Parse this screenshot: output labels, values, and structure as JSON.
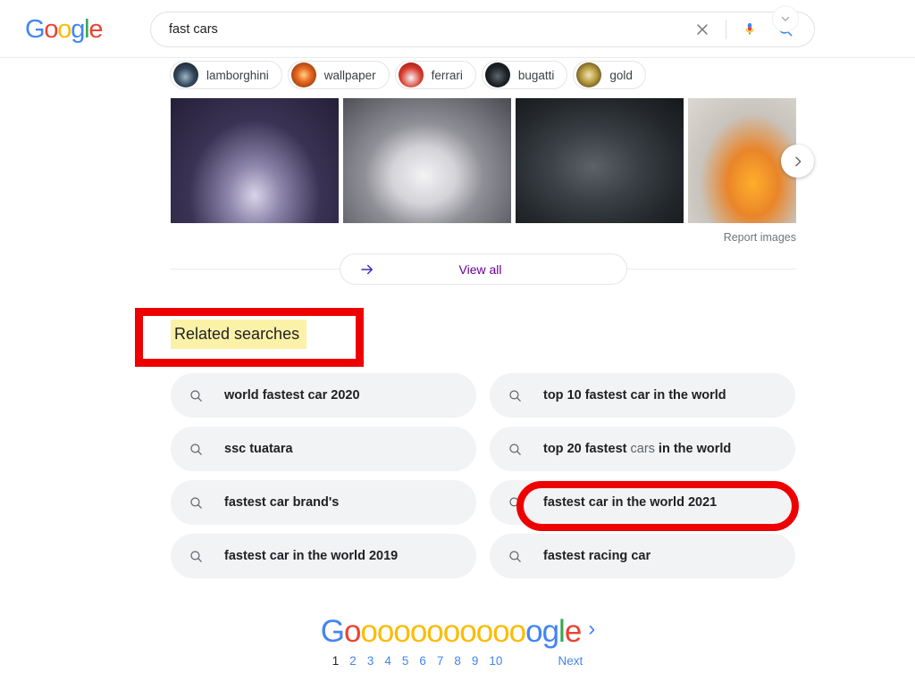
{
  "header": {
    "logo_text": "Google",
    "logo_letters": [
      {
        "ch": "G",
        "color": "#4285F4"
      },
      {
        "ch": "o",
        "color": "#EA4335"
      },
      {
        "ch": "o",
        "color": "#FBBC05"
      },
      {
        "ch": "g",
        "color": "#4285F4"
      },
      {
        "ch": "l",
        "color": "#34A853"
      },
      {
        "ch": "e",
        "color": "#EA4335"
      }
    ],
    "search": {
      "value": "fast cars",
      "placeholder": "Search",
      "clear_label": "Clear",
      "voice_label": "Search by voice",
      "search_label": "Google Search"
    }
  },
  "chips": {
    "items": [
      {
        "label": "lamborghini"
      },
      {
        "label": "wallpaper"
      },
      {
        "label": "ferrari"
      },
      {
        "label": "bugatti"
      },
      {
        "label": "gold"
      }
    ],
    "expand_label": "More filters"
  },
  "images": {
    "cells": [
      {
        "alt": "dark purple concept hypercar at night"
      },
      {
        "alt": "white Lykan sports car on desert road"
      },
      {
        "alt": "dark grey Bugatti Chiron with orange stripe"
      },
      {
        "alt": "orange Ford Mustang on salt flat"
      }
    ],
    "next_label": "Next",
    "report_label": "Report images",
    "view_all_label": "View all",
    "view_all_color": "#660099"
  },
  "related": {
    "heading": "Related searches",
    "heading_highlight_color": "#fbf2a8",
    "annotation_color": "#ee0000",
    "columns": [
      {
        "items": [
          {
            "parts": [
              {
                "text": "world fastest car 2020",
                "bold": true
              }
            ]
          },
          {
            "parts": [
              {
                "text": "ssc tuatara",
                "bold": true
              }
            ]
          },
          {
            "parts": [
              {
                "text": "fastest car brand's",
                "bold": true
              }
            ]
          },
          {
            "parts": [
              {
                "text": "fastest car in the world 2019",
                "bold": true
              }
            ]
          }
        ]
      },
      {
        "items": [
          {
            "parts": [
              {
                "text": "top 10 fastest car in the world",
                "bold": true
              }
            ]
          },
          {
            "parts": [
              {
                "text": "top 20 fastest ",
                "bold": true
              },
              {
                "text": "cars",
                "bold": false
              },
              {
                "text": " in the world",
                "bold": true
              }
            ]
          },
          {
            "parts": [
              {
                "text": "fastest car in the world 2021",
                "bold": true
              }
            ],
            "annotated": true
          },
          {
            "parts": [
              {
                "text": "fastest racing car",
                "bold": true
              }
            ]
          }
        ]
      }
    ]
  },
  "footer": {
    "logo_letters": [
      {
        "ch": "G",
        "color": "#4285F4"
      },
      {
        "ch": "o",
        "color": "#EA4335"
      },
      {
        "ch": "o",
        "color": "#FBBC05"
      },
      {
        "ch": "o",
        "color": "#FBBC05"
      },
      {
        "ch": "o",
        "color": "#FBBC05"
      },
      {
        "ch": "o",
        "color": "#FBBC05"
      },
      {
        "ch": "o",
        "color": "#FBBC05"
      },
      {
        "ch": "o",
        "color": "#FBBC05"
      },
      {
        "ch": "o",
        "color": "#FBBC05"
      },
      {
        "ch": "o",
        "color": "#FBBC05"
      },
      {
        "ch": "o",
        "color": "#FBBC05"
      },
      {
        "ch": "o",
        "color": "#FBBC05"
      },
      {
        "ch": "o",
        "color": "#4285F4"
      },
      {
        "ch": "g",
        "color": "#4285F4"
      },
      {
        "ch": "l",
        "color": "#34A853"
      },
      {
        "ch": "e",
        "color": "#EA4335"
      }
    ],
    "pages": [
      "1",
      "2",
      "3",
      "4",
      "5",
      "6",
      "7",
      "8",
      "9",
      "10"
    ],
    "current_page": "1",
    "next_label": "Next"
  }
}
